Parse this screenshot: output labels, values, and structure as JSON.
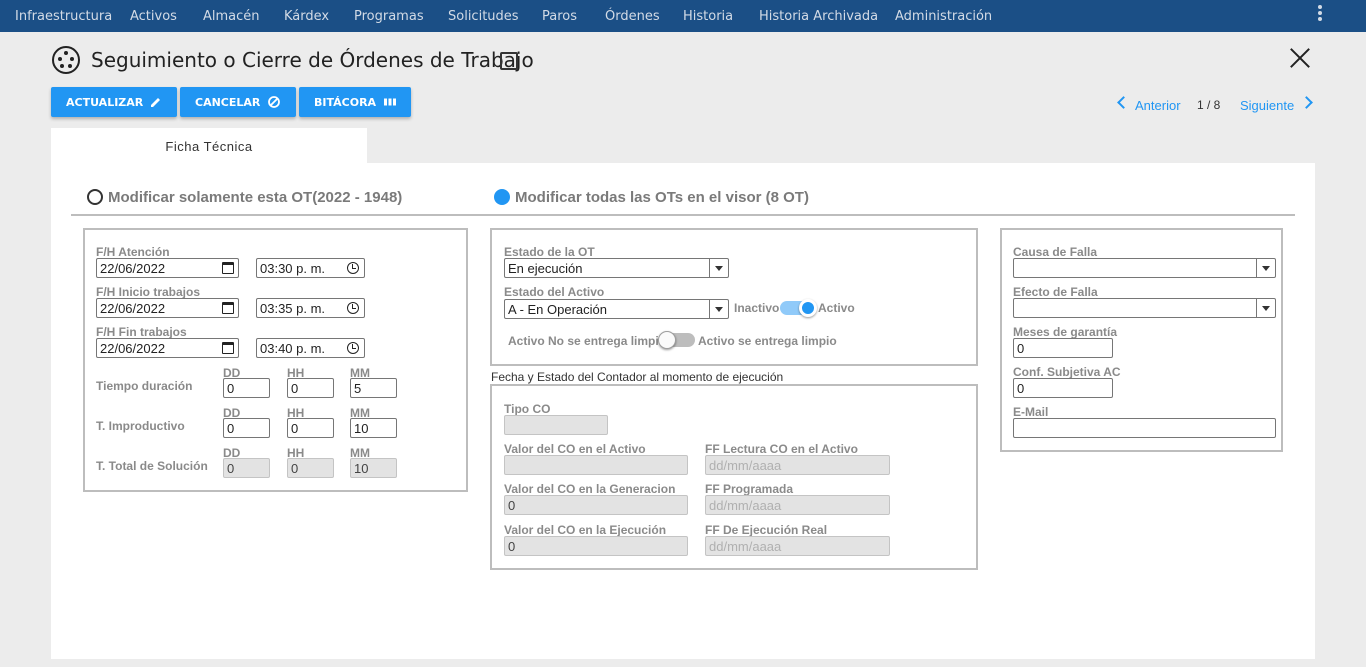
{
  "nav": [
    "Infraestructura",
    "Activos",
    "Almacén",
    "Kárdex",
    "Programas",
    "Solicitudes",
    "Paros",
    "Órdenes",
    "Historia",
    "Historia Archivada",
    "Administración"
  ],
  "header": {
    "title": "Seguimiento o Cierre de Órdenes de Trabajo"
  },
  "toolbar": {
    "update": "ACTUALIZAR",
    "cancel": "CANCELAR",
    "log": "BITÁCORA"
  },
  "pager": {
    "prev": "Anterior",
    "count": "1 / 8",
    "next": "Siguiente"
  },
  "tab": "Ficha Técnica",
  "scope": {
    "only_this": "Modificar solamente esta OT(2022 - 1948)",
    "all": "Modificar todas las OTs en el visor (8 OT)",
    "selected": "all"
  },
  "times": {
    "attention_label": "F/H Atención",
    "attention_date": "22/06/2022",
    "attention_time": "03:30 p. m.",
    "start_label": "F/H Inicio trabajos",
    "start_date": "22/06/2022",
    "start_time": "03:35 p. m.",
    "end_label": "F/H Fin trabajos",
    "end_date": "22/06/2022",
    "end_time": "03:40 p. m.",
    "dd": "DD",
    "hh": "HH",
    "mm": "MM",
    "duration_label": "Tiempo duración",
    "duration": [
      "0",
      "0",
      "5"
    ],
    "unproductive_label": "T. Improductivo",
    "unproductive": [
      "0",
      "0",
      "10"
    ],
    "total_label": "T. Total de Solución",
    "total": [
      "0",
      "0",
      "10"
    ]
  },
  "status": {
    "ot_label": "Estado de la OT",
    "ot_value": "En ejecución",
    "asset_label": "Estado del Activo",
    "asset_value": "A - En Operación",
    "inactive": "Inactivo",
    "active": "Activo",
    "asset_active": true,
    "not_clean": "Activo No se entrega limpio",
    "clean": "Activo se entrega limpio",
    "clean_on": false
  },
  "counter": {
    "section_label": "Fecha y Estado del Contador al momento de ejecución",
    "type_label": "Tipo CO",
    "type_value": "",
    "co_asset_label": "Valor del CO en el Activo",
    "co_asset_value": "",
    "ff_reading_label": "FF Lectura CO en el Activo",
    "ff_reading_ph": "dd/mm/aaaa",
    "co_gen_label": "Valor del CO en la Generacion",
    "co_gen_value": "0",
    "ff_planned_label": "FF Programada",
    "ff_planned_ph": "dd/mm/aaaa",
    "co_exec_label": "Valor del CO en la Ejecución",
    "co_exec_value": "0",
    "ff_real_label": "FF De Ejecución Real",
    "ff_real_ph": "dd/mm/aaaa"
  },
  "failure": {
    "cause_label": "Causa de Falla",
    "cause_value": "",
    "effect_label": "Efecto de Falla",
    "effect_value": "",
    "warranty_label": "Meses de garantía",
    "warranty_value": "0",
    "conf_label": "Conf. Subjetiva AC",
    "conf_value": "0",
    "email_label": "E-Mail",
    "email_value": ""
  },
  "colors": {
    "nav_bg": "#1b4f86",
    "accent": "#2196f3",
    "page_bg": "#ececec"
  },
  "icons": [
    "film-reel-icon",
    "pencil-icon",
    "block-icon",
    "columns-icon",
    "chevron-left-icon",
    "chevron-right-icon",
    "close-icon",
    "calendar-icon",
    "clock-icon",
    "dropdown-arrow-icon",
    "more-vert-icon"
  ]
}
